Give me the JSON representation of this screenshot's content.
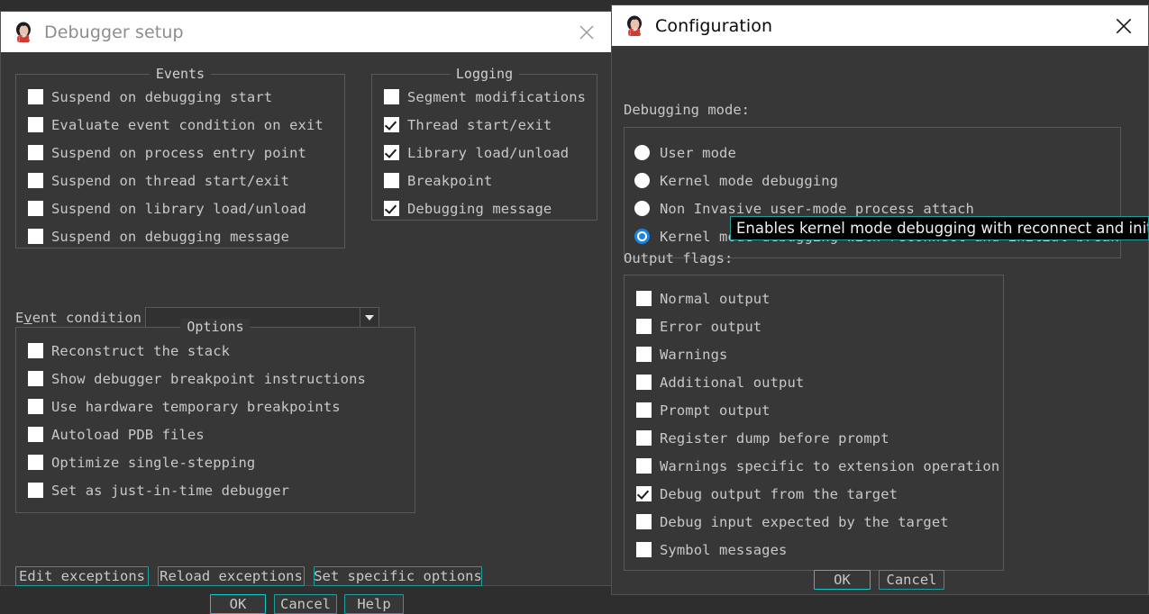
{
  "debugger_setup": {
    "title": "Debugger setup",
    "icon": "ida-app-icon",
    "close_label": "×",
    "events_group": {
      "title": "Events",
      "items": [
        {
          "label": "Suspend on debugging start",
          "checked": false
        },
        {
          "label": "Evaluate event condition on exit",
          "checked": false
        },
        {
          "label": "Suspend on process entry point",
          "checked": false
        },
        {
          "label": "Suspend on thread start/exit",
          "checked": false
        },
        {
          "label": "Suspend on library load/unload",
          "checked": false
        },
        {
          "label": "Suspend on debugging message",
          "checked": false
        }
      ]
    },
    "logging_group": {
      "title": "Logging",
      "items": [
        {
          "label": "Segment modifications",
          "checked": false
        },
        {
          "label": "Thread start/exit",
          "checked": true
        },
        {
          "label": "Library load/unload",
          "checked": true
        },
        {
          "label": "Breakpoint",
          "checked": false
        },
        {
          "label": "Debugging message",
          "checked": true
        }
      ]
    },
    "event_condition": {
      "label_before": "E",
      "label_accel": "v",
      "label_after": "ent condition",
      "value": "",
      "placeholder": ""
    },
    "options_group": {
      "title": "Options",
      "items": [
        {
          "label": "Reconstruct the stack",
          "checked": false
        },
        {
          "label": "Show debugger breakpoint instructions",
          "checked": false
        },
        {
          "label": "Use hardware temporary breakpoints",
          "checked": false
        },
        {
          "label": "Autoload PDB files",
          "checked": false
        },
        {
          "label": "Optimize single-stepping",
          "checked": false
        },
        {
          "label": "Set as just-in-time debugger",
          "checked": false
        }
      ]
    },
    "buttons": {
      "edit_exceptions": "Edit exceptions",
      "reload_exceptions": "Reload exceptions",
      "set_specific_options": "Set specific options",
      "ok": "OK",
      "cancel": "Cancel",
      "help": "Help"
    }
  },
  "configuration": {
    "title": "Configuration",
    "icon": "ida-app-icon",
    "close_label": "×",
    "debugging_mode_label": "Debugging mode:",
    "debugging_modes": [
      {
        "label": "User mode",
        "selected": false
      },
      {
        "label": "Kernel mode debugging",
        "selected": false
      },
      {
        "label": "Non Invasive user-mode process attach",
        "selected": false
      },
      {
        "label": "Kernel mode debugging with reconnect and initial break",
        "selected": true
      }
    ],
    "output_flags_label": "Output flags:",
    "output_flags": [
      {
        "label": "Normal output",
        "checked": false
      },
      {
        "label": "Error output",
        "checked": false
      },
      {
        "label": "Warnings",
        "checked": false
      },
      {
        "label": "Additional output",
        "checked": false
      },
      {
        "label": "Prompt output",
        "checked": false
      },
      {
        "label": "Register dump before prompt",
        "checked": false
      },
      {
        "label": "Warnings specific to extension operation",
        "checked": false
      },
      {
        "label": "Debug output from the target",
        "checked": true
      },
      {
        "label": "Debug input expected by the target",
        "checked": false
      },
      {
        "label": "Symbol messages",
        "checked": false
      }
    ],
    "buttons": {
      "ok": "OK",
      "cancel": "Cancel"
    }
  },
  "tooltip": {
    "text": "Enables kernel mode debugging with reconnect and initial break"
  },
  "colors": {
    "window_bg": "#373737",
    "titlebar_bg": "#ffffff",
    "text": "#c8c8c8",
    "accent_teal": "#1f9e9e",
    "accent_teal_bright": "#17c6c6",
    "radio_blue": "#1a84e0",
    "group_border": "#595959"
  }
}
